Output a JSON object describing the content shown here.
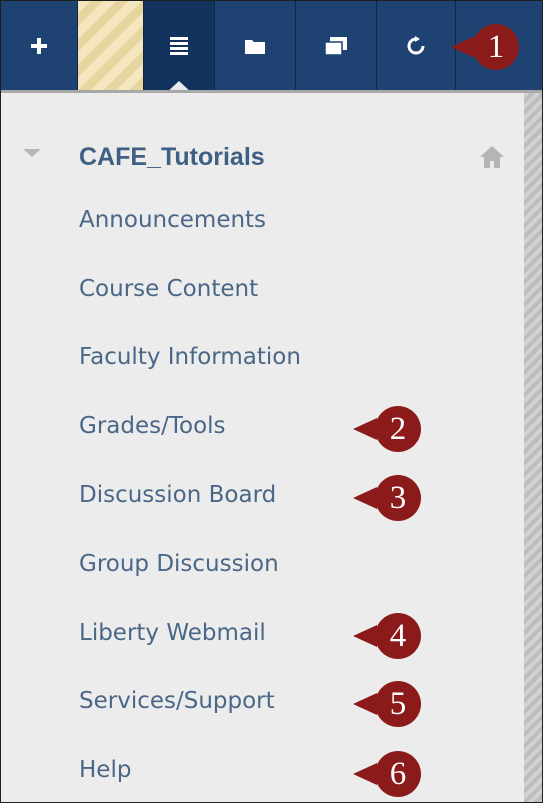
{
  "toolbar": {
    "buttons": [
      {
        "name": "add-button",
        "icon": "plus-icon"
      },
      {
        "name": "edit-mode-toggle",
        "icon": "stripe-pattern"
      },
      {
        "name": "course-menu-tab",
        "icon": "list-icon"
      },
      {
        "name": "folder-view-button",
        "icon": "folder-icon"
      },
      {
        "name": "new-window-button",
        "icon": "window-icon"
      },
      {
        "name": "refresh-button",
        "icon": "refresh-icon"
      }
    ],
    "colors": {
      "bar": "#1e4272",
      "active": "#12335d"
    }
  },
  "course": {
    "title": "CAFE_Tutorials"
  },
  "menu": {
    "items": [
      {
        "label": "Announcements"
      },
      {
        "label": "Course Content"
      },
      {
        "label": "Faculty Information"
      },
      {
        "label": "Grades/Tools"
      },
      {
        "label": "Discussion Board"
      },
      {
        "label": "Group Discussion"
      },
      {
        "label": "Liberty Webmail"
      },
      {
        "label": "Services/Support"
      },
      {
        "label": "Help"
      }
    ]
  },
  "markers": [
    {
      "number": "1"
    },
    {
      "number": "2"
    },
    {
      "number": "3"
    },
    {
      "number": "4"
    },
    {
      "number": "5"
    },
    {
      "number": "6"
    }
  ],
  "marker_color": "#8b1a1a"
}
